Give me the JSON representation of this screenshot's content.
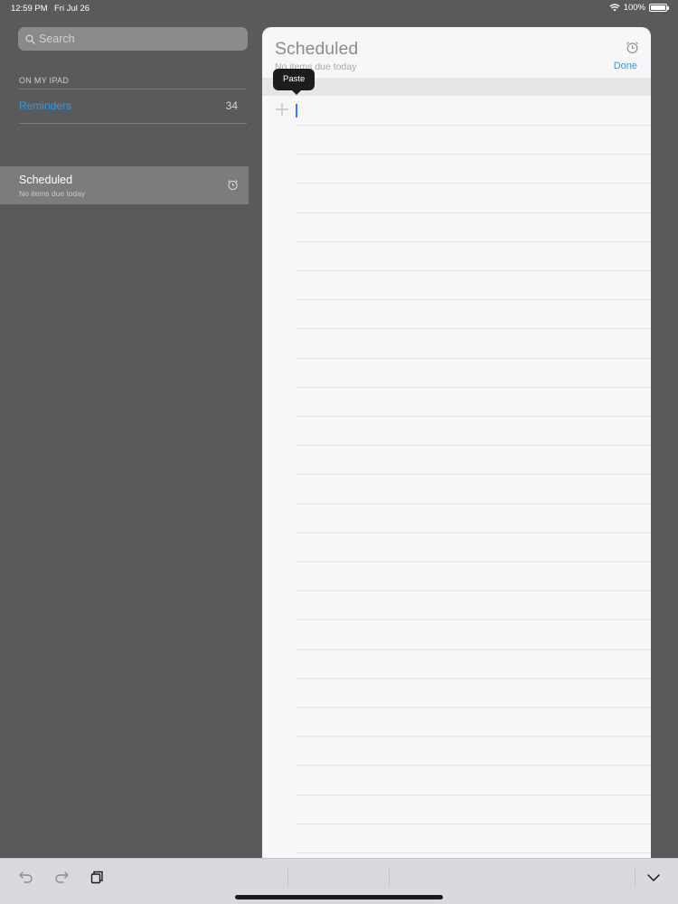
{
  "status_bar": {
    "time": "12:59 PM",
    "date": "Fri Jul 26",
    "battery": "100%",
    "battery_level": 1.0
  },
  "sidebar": {
    "search_placeholder": "Search",
    "section_header": "ON MY IPAD",
    "lists": [
      {
        "label": "Reminders",
        "count": "34",
        "color": "#2e99e4"
      }
    ],
    "scheduled": {
      "title": "Scheduled",
      "subtitle": "No items due today",
      "icon": "alarm-clock-icon"
    }
  },
  "main": {
    "title": "Scheduled",
    "subtitle": "No items due today",
    "done_label": "Done",
    "paste_label": "Paste",
    "accent_color": "#2e99e4"
  },
  "toolbar": {
    "icons": [
      "undo-icon",
      "redo-icon",
      "clipboard-icon",
      "keyboard-dismiss-icon"
    ]
  }
}
